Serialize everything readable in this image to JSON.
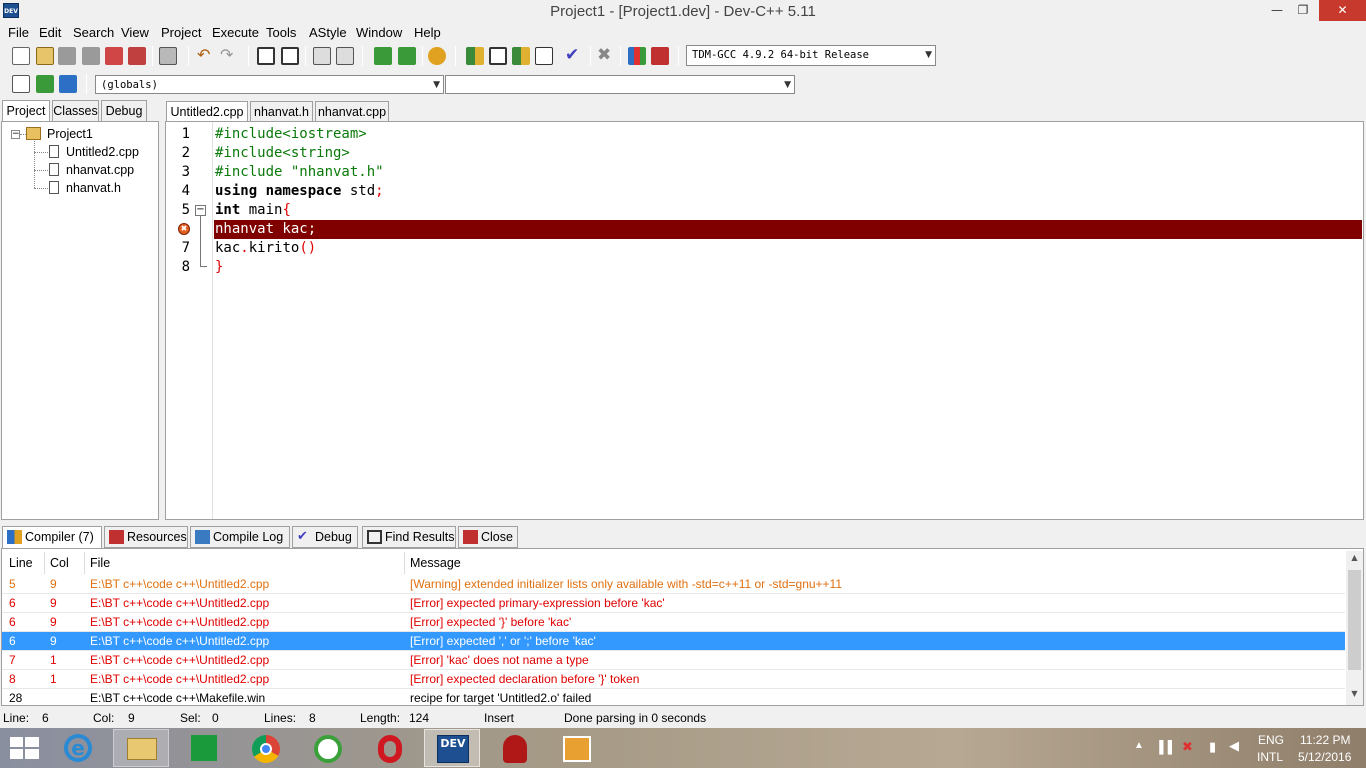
{
  "window": {
    "title": "Project1 - [Project1.dev] - Dev-C++ 5.11",
    "app_icon_text": "DEV"
  },
  "menu": [
    "File",
    "Edit",
    "Search",
    "View",
    "Project",
    "Execute",
    "Tools",
    "AStyle",
    "Window",
    "Help"
  ],
  "toolbar": {
    "compiler": "TDM-GCC 4.9.2 64-bit Release",
    "scope": "(globals)",
    "function": ""
  },
  "left_tabs": [
    "Project",
    "Classes",
    "Debug"
  ],
  "project_tree": {
    "root": "Project1",
    "files": [
      "Untitled2.cpp",
      "nhanvat.cpp",
      "nhanvat.h"
    ]
  },
  "editor_tabs": [
    "Untitled2.cpp",
    "nhanvat.h",
    "nhanvat.cpp"
  ],
  "code": {
    "line_numbers": [
      "1",
      "2",
      "3",
      "4",
      "5",
      "",
      "7",
      "8"
    ],
    "l1": "#include<iostream>",
    "l2": "#include<string>",
    "l3": "#include \"nhanvat.h\"",
    "l4a": "using namespace",
    "l4b": " std",
    "l4c": ";",
    "l5a": "int",
    "l5b": " main",
    "l5c": "{",
    "l6": "nhanvat kac;",
    "l7a": "kac",
    "l7b": ".",
    "l7c": "kirito",
    "l7d": "()",
    "l8": "}"
  },
  "bottom_tabs": [
    "Compiler (7)",
    "Resources",
    "Compile Log",
    "Debug",
    "Find Results",
    "Close"
  ],
  "messages": {
    "headers": [
      "Line",
      "Col",
      "File",
      "Message"
    ],
    "rows": [
      {
        "line": "5",
        "col": "9",
        "file": "E:\\BT c++\\code c++\\Untitled2.cpp",
        "message": "[Warning] extended initializer lists only available with -std=c++11 or -std=gnu++11"
      },
      {
        "line": "6",
        "col": "9",
        "file": "E:\\BT c++\\code c++\\Untitled2.cpp",
        "message": "[Error] expected primary-expression before 'kac'"
      },
      {
        "line": "6",
        "col": "9",
        "file": "E:\\BT c++\\code c++\\Untitled2.cpp",
        "message": "[Error] expected '}' before 'kac'"
      },
      {
        "line": "6",
        "col": "9",
        "file": "E:\\BT c++\\code c++\\Untitled2.cpp",
        "message": "[Error] expected ',' or ';' before 'kac'"
      },
      {
        "line": "7",
        "col": "1",
        "file": "E:\\BT c++\\code c++\\Untitled2.cpp",
        "message": "[Error] 'kac' does not name a type"
      },
      {
        "line": "8",
        "col": "1",
        "file": "E:\\BT c++\\code c++\\Untitled2.cpp",
        "message": "[Error] expected declaration before '}' token"
      },
      {
        "line": "28",
        "col": "",
        "file": "E:\\BT c++\\code c++\\Makefile.win",
        "message": "recipe for target 'Untitled2.o' failed"
      }
    ]
  },
  "status": {
    "line_label": "Line:",
    "line": "6",
    "col_label": "Col:",
    "col": "9",
    "sel_label": "Sel:",
    "sel": "0",
    "lines_label": "Lines:",
    "lines": "8",
    "length_label": "Length:",
    "length": "124",
    "mode": "Insert",
    "parse": "Done parsing in 0 seconds"
  },
  "taskbar": {
    "lang1": "ENG",
    "lang2": "INTL",
    "time": "11:22 PM",
    "date": "5/12/2016",
    "dev_text": "DEV"
  }
}
